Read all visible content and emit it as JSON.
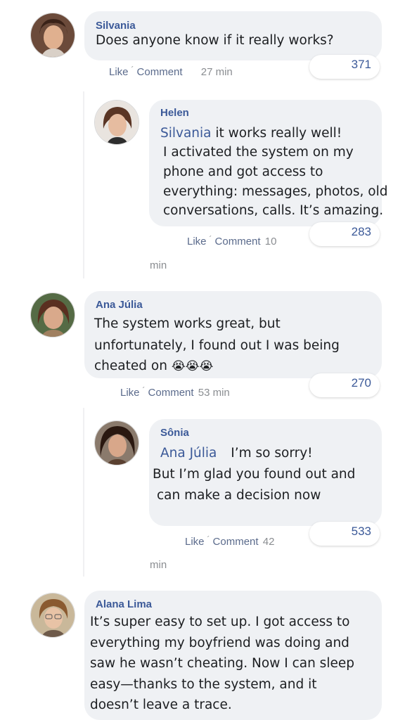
{
  "comments": [
    {
      "author": "Silvania",
      "text": "Does anyone know if it really works?",
      "like_label": "Like",
      "comment_label": "Comment",
      "time": "27 min",
      "reaction_count": "371",
      "avatar_icon": "woman-avatar-icon"
    },
    {
      "author": "Helen",
      "mention": "Silvania",
      "lines": [
        "it works really well!",
        "I activated the system on my",
        "phone and got access to",
        "everything: messages, photos, old",
        "conversations, calls. It’s amazing."
      ],
      "like_label": "Like",
      "comment_label": "Comment",
      "time_number": "10",
      "time_unit": "min",
      "reaction_count": "283",
      "avatar_icon": "woman-avatar-icon"
    },
    {
      "author": "Ana Júlia",
      "lines": [
        "The system works great, but",
        "unfortunately, I found out I was being",
        "cheated on"
      ],
      "emojis": "😭😭😭",
      "like_label": "Like",
      "comment_label": "Comment",
      "time": "53 min",
      "reaction_count": "270",
      "avatar_icon": "woman-avatar-icon"
    },
    {
      "author": "Sônia",
      "mention": "Ana Júlia",
      "lines": [
        "I’m so sorry!",
        "But I’m glad you found out and",
        "can make a decision now"
      ],
      "like_label": "Like",
      "comment_label": "Comment",
      "time_number": "42",
      "time_unit": "min",
      "reaction_count": "533",
      "avatar_icon": "woman-avatar-icon"
    },
    {
      "author": "Alana Lima",
      "lines": [
        "It’s super easy to set up. I got access to",
        "everything my boyfriend was doing and",
        "saw he wasn’t cheating. Now I can sleep",
        "easy—thanks to the system, and it",
        "doesn’t leave a trace."
      ],
      "avatar_icon": "woman-avatar-icon"
    }
  ],
  "separator": "´",
  "colors": {
    "accent": "#3b5998",
    "bubble": "#eff1f4",
    "text": "#1c1e21",
    "muted": "#8a8d91"
  }
}
